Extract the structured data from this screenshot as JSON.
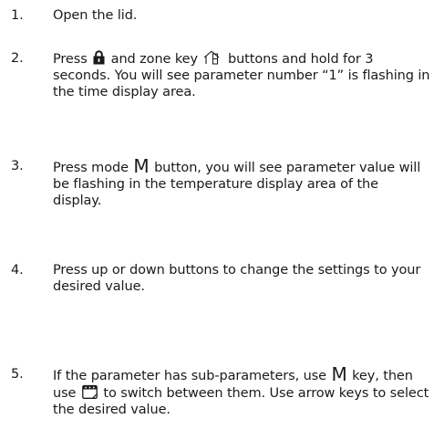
{
  "steps": [
    {
      "number": "1.",
      "text": "Open the lid."
    },
    {
      "number": "2.",
      "parts": [
        "Press ",
        " and zone key ",
        " buttons and hold for 3 seconds. You will see parameter number “1” is flashing in the time display area."
      ],
      "icons": [
        "lock-icon",
        "zone-key-icon"
      ]
    },
    {
      "number": "3.",
      "parts": [
        "Press mode ",
        "M",
        " button, you will see parameter value will be flashing in the temperature display area of the display."
      ]
    },
    {
      "number": "4.",
      "text": "Press up or down buttons to change the settings to your desired value."
    },
    {
      "number": "5.",
      "parts": [
        "If the parameter has sub-parameters, use ",
        "M",
        " key, then use ",
        " to switch between them. Use arrow keys to select the desired value."
      ],
      "icons": [
        "calendar-icon"
      ]
    }
  ]
}
